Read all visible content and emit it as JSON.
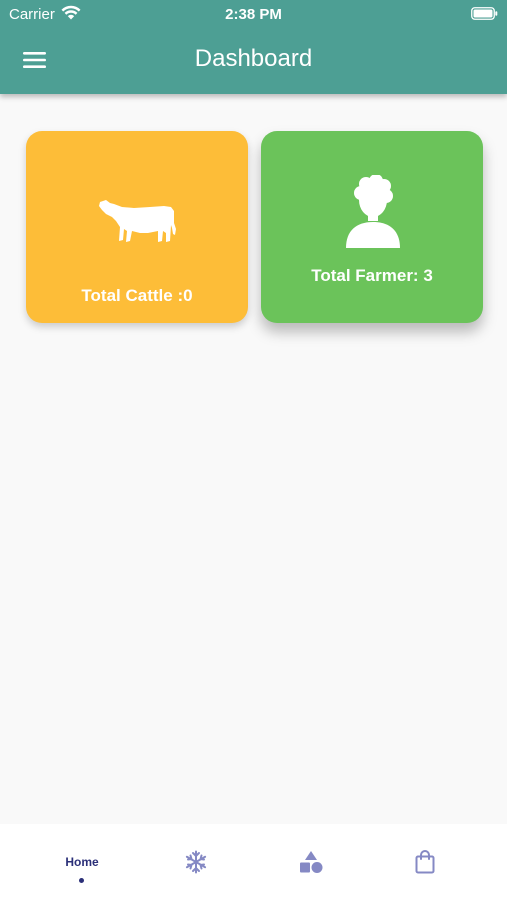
{
  "status_bar": {
    "carrier": "Carrier",
    "time": "2:38 PM",
    "wifi_icon": "wifi-icon",
    "battery_icon": "battery-icon"
  },
  "header": {
    "title": "Dashboard",
    "menu_icon": "hamburger-menu-icon",
    "background_color": "#4d9f94"
  },
  "cards": {
    "cattle": {
      "label": "Total Cattle :0",
      "icon": "cow-icon",
      "color": "#fdbd38"
    },
    "farmer": {
      "label": "Total Farmer: 3",
      "icon": "person-icon",
      "color": "#6bc35a"
    }
  },
  "bottom_nav": {
    "items": [
      {
        "label": "Home",
        "icon": "",
        "active": true
      },
      {
        "label": "",
        "icon": "snowflake-icon",
        "active": false
      },
      {
        "label": "",
        "icon": "shapes-icon",
        "active": false
      },
      {
        "label": "",
        "icon": "shopping-bag-icon",
        "active": false
      }
    ],
    "active_color": "#2b2f78",
    "icon_color": "#8589c4"
  }
}
